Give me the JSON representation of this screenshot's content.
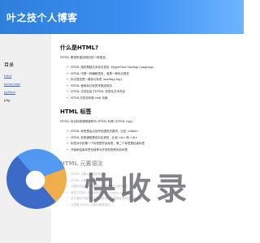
{
  "header": {
    "site_title": "叶之技个人博客"
  },
  "sidebar": {
    "toc_title": "目录",
    "links": [
      "html",
      "javascript",
      "python"
    ],
    "plain_item": "php"
  },
  "main": {
    "section1": {
      "heading": "什么是HTML?",
      "intro": "HTML 是用来描述网页的一种语言。",
      "items": [
        "HTML 指的是超文本标记语言: HyperText Markup Language",
        "HTML 不是一种编程语言，而是一种标记语言",
        "标记语言是一套标记标签 (markup tag)",
        "HTML 使用标记标签来描述网页",
        "HTML 文档包含了HTML 标签及文本内容",
        "HTML文档也叫做 web 页面"
      ]
    },
    "section2": {
      "heading": "HTML 标签",
      "intro": "HTML 标记标签通常被称为 HTML 标签 (HTML tag)。",
      "items": [
        "HTML 标签是由尖括号包围的关键词，比如 <html>",
        "HTML 标签通常是成对出现的，比如 <b> 和 </b>",
        "标签对中的第一个标签是开始标签，第二个标签是结束标签",
        "开始和结束标签也被称为开放标签和闭合标签"
      ]
    },
    "section3": {
      "heading": "HTML 元素语法",
      "items": [
        "HTML 元素以开始标签起始",
        "HTML 元素以结束标签终止",
        "元素的内容是开始标签与结束标签之间的内容",
        "某些 HTML 元素具有空内容 (empty content)",
        "空元素在开始标签中进行关闭（以开始标签的结束而结束）",
        "大多数 HTML 元素可拥有属性"
      ]
    }
  },
  "watermark": {
    "text": "快收录"
  }
}
